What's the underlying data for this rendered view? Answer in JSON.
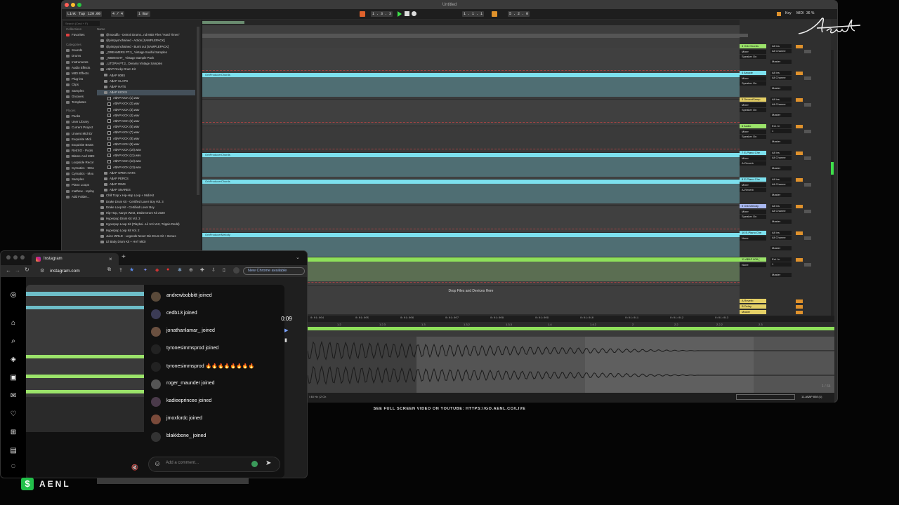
{
  "daw": {
    "title": "Untitled",
    "transport": {
      "link": "Link",
      "tap": "Tap",
      "tempo": "120.00",
      "signature": "4 / 4",
      "quantize": "1 Bar",
      "position": "1 .  3 .  3",
      "loop_start": "1 .  1 .  1",
      "loop_length": "5 .  2 .  0",
      "key_label": "Key",
      "midi_label": "MIDI",
      "cpu": "36 %"
    },
    "browser": {
      "search_placeholder": "Search (Cmd + F)",
      "collections_heading": "Collections",
      "favorites": "Favorites",
      "categories_heading": "Categories",
      "categories": [
        "Sounds",
        "Drums",
        "Instruments",
        "Audio Effects",
        "MIDI Effects",
        "Plug-ins",
        "Clips",
        "Samples",
        "Grooves",
        "Templates"
      ],
      "places_heading": "Places",
      "places": [
        "Packs",
        "User Library",
        "Current Project",
        "Unsent Midi Dr",
        "Exquisite Midi",
        "Exquisite Beats",
        "RetrXO - Pools",
        "Blame And MIDI",
        "Loopside Recor",
        "Cymatics - 90sc",
        "Cymatics - Mou",
        "Samples",
        "Piano Loops",
        "mathew - replay",
        "Add Folder..."
      ],
      "name_header": "Name",
      "files": [
        {
          "name": "@moodfix - Detroit Drums...nd MIDI Files \"Hard Times\"",
          "type": "folder",
          "indent": 1
        },
        {
          "name": "@pimpyonchained - Action [SAMPLEPACK]",
          "type": "folder",
          "indent": 1
        },
        {
          "name": "@pimpyonchained - Burnt out [SAMPLEPACK]",
          "type": "folder",
          "indent": 1
        },
        {
          "name": "_DREAMERS PT.3_ Vintage Soulful Samples",
          "type": "folder",
          "indent": 1
        },
        {
          "name": "_MIDNIGHT_ Vintage Sample Pack",
          "type": "folder",
          "indent": 1
        },
        {
          "name": "_UTOPIA PT.2_ Dreamy Vintage Samples",
          "type": "folder",
          "indent": 1
        },
        {
          "name": "A$AP Rocky Drum Kit",
          "type": "folder",
          "indent": 1
        },
        {
          "name": "A$AP 808S",
          "type": "folder",
          "indent": 2
        },
        {
          "name": "A$AP CLAPS",
          "type": "folder",
          "indent": 2
        },
        {
          "name": "A$AP HATS",
          "type": "folder",
          "indent": 2
        },
        {
          "name": "A$AP KICKS",
          "type": "folder",
          "indent": 2,
          "selected": true
        },
        {
          "name": "A$AP KICK (1).wav",
          "type": "wav",
          "indent": 3
        },
        {
          "name": "A$AP KICK (2).wav",
          "type": "wav",
          "indent": 3
        },
        {
          "name": "A$AP KICK (3).wav",
          "type": "wav",
          "indent": 3
        },
        {
          "name": "A$AP KICK (4).wav",
          "type": "wav",
          "indent": 3
        },
        {
          "name": "A$AP KICK (5).wav",
          "type": "wav",
          "indent": 3
        },
        {
          "name": "A$AP KICK (6).wav",
          "type": "wav",
          "indent": 3
        },
        {
          "name": "A$AP KICK (7).wav",
          "type": "wav",
          "indent": 3
        },
        {
          "name": "A$AP KICK (8).wav",
          "type": "wav",
          "indent": 3
        },
        {
          "name": "A$AP KICK (9).wav",
          "type": "wav",
          "indent": 3
        },
        {
          "name": "A$AP KICK (10).wav",
          "type": "wav",
          "indent": 3
        },
        {
          "name": "A$AP KICK (11).wav",
          "type": "wav",
          "indent": 3
        },
        {
          "name": "A$AP KICK (12).wav",
          "type": "wav",
          "indent": 3
        },
        {
          "name": "A$AP KICK (13).wav",
          "type": "wav",
          "indent": 3
        },
        {
          "name": "A$AP OPEN HATS",
          "type": "folder",
          "indent": 2
        },
        {
          "name": "A$AP PERCS",
          "type": "folder",
          "indent": 2
        },
        {
          "name": "A$AP RIMS",
          "type": "folder",
          "indent": 2
        },
        {
          "name": "A$AP SNARES",
          "type": "folder",
          "indent": 2
        },
        {
          "name": "Chill Trap x Hip-Hop Loop + Midi Kit",
          "type": "folder",
          "indent": 1
        },
        {
          "name": "Drake Drum Kit - Certified Lover Boy Vol. 3",
          "type": "folder",
          "indent": 1
        },
        {
          "name": "Drake Loop Kit - Certified Lover Boy",
          "type": "folder",
          "indent": 1
        },
        {
          "name": "Hip-Hop, Kanye West, Drake Drum Kit 2020",
          "type": "folder",
          "indent": 1
        },
        {
          "name": "Hyperpop Drum Kit Vol. 3",
          "type": "folder",
          "indent": 1
        },
        {
          "name": "Hyperpop Loop Kit (Playboi...Lil Uzi Vert, Trippie Redd)",
          "type": "folder",
          "indent": 1
        },
        {
          "name": "Hyperpop Loop Kit Vol. 2",
          "type": "folder",
          "indent": 1
        },
        {
          "name": "Juice WRLD - Legends Never Die Drum Kit + Bonus",
          "type": "folder",
          "indent": 1
        },
        {
          "name": "Lil Baby Drum Kit + HAT MIDI",
          "type": "folder",
          "indent": 1
        }
      ]
    },
    "clips": [
      {
        "label": "OrbProducerChords",
        "track": 1
      },
      {
        "label": "OrbProducerChords",
        "track": 4
      },
      {
        "label": "OrbProducerChords",
        "track": 5
      },
      {
        "label": "OrbProducerMelody",
        "track": 7
      },
      {
        "label": "808 (1)",
        "track": 8
      }
    ],
    "drop_text": "Drop Files and Devices Here",
    "tracks": [
      {
        "name": "3 Orb Chords",
        "color": "#9be36a",
        "input": "All Ins",
        "channel": "All Channe",
        "mode": "Mixer",
        "out": "Speaker On",
        "route": "Master"
      },
      {
        "name": "4 Arcade",
        "color": "#7ce0ee",
        "input": "All Ins",
        "channel": "All Channe",
        "mode": "Mixer",
        "out": "Speaker On",
        "route": "Master"
      },
      {
        "name": "5 DecentSamp",
        "color": "#e5d066",
        "input": "All Ins",
        "channel": "All Channe",
        "mode": "Mixer",
        "out": "Speaker On",
        "route": "Master"
      },
      {
        "name": "6 Audio",
        "color": "#9be36a",
        "input": "Ext. In",
        "channel": "1",
        "mode": "Mixer",
        "out": "Speaker On",
        "route": "Master"
      },
      {
        "name": "7 E-Piano Che",
        "color": "#7ce0ee",
        "input": "All Ins",
        "channel": "All Channe",
        "mode": "Mixer",
        "out": "A-Reverb",
        "route": "Master"
      },
      {
        "name": "8 E-Piano Che",
        "color": "#7ce0ee",
        "input": "All Ins",
        "channel": "All Channe",
        "mode": "Mixer",
        "out": "A-Reverb",
        "route": "Master"
      },
      {
        "name": "9 Orb Melody",
        "color": "#a9b8f0",
        "input": "All Ins",
        "channel": "All Channe",
        "mode": "Mixer",
        "out": "Speaker On",
        "route": "Master"
      },
      {
        "name": "10 E-Piano Che",
        "color": "#7ce0ee",
        "input": "All Ins",
        "channel": "All Channe",
        "mode": "None",
        "out": "",
        "route": "Master"
      },
      {
        "name": "11 A$AP 808 (",
        "color": "#9be36a",
        "input": "Ext. In",
        "channel": "1",
        "mode": "None",
        "out": "",
        "route": "Master"
      }
    ],
    "returns": [
      {
        "name": "A Reverb",
        "color": "#e5d066"
      },
      {
        "name": "B Delay",
        "color": "#e5d066"
      },
      {
        "name": "Master",
        "color": "#e5d066"
      }
    ],
    "detail": {
      "ruler_ticks": [
        "0:01:004",
        "0:01:005",
        "0:01:006",
        "0:01:007",
        "0:01:008",
        "0:01:009",
        "0:01:010",
        "0:01:011",
        "0:01:012",
        "0:01:013"
      ],
      "bar_ticks": [
        "1.2",
        "1.2.3",
        "1.3",
        "1.3.2",
        "1.3.3",
        "1.4",
        "1.4.2",
        "2",
        "2.2",
        "2.2.2",
        "2.3"
      ],
      "page": "1 / 64",
      "status_left": "/ 48 Hz | 2 Ch",
      "status_right": "11-A$AP 808 (1)"
    }
  },
  "browser_window": {
    "tab_title": "Instagram",
    "url": "instagram.com",
    "update_text": "New Chrome available",
    "comments": [
      {
        "text": "andrewbobbitt joined"
      },
      {
        "text": "cedb13 joined"
      },
      {
        "text": "jonathanlamar_ joined"
      },
      {
        "text": "tyronesimmsprod joined"
      },
      {
        "text": "tyronesimmsprod 🔥🔥🔥🔥🔥🔥🔥🔥"
      },
      {
        "text": "roger_maunder joined"
      },
      {
        "text": "kadieeprincee joined"
      },
      {
        "text": "jmoxfordc joined"
      },
      {
        "text": "blakkbone_ joined"
      }
    ],
    "comment_placeholder": "Add a comment...",
    "timer": "0:09"
  },
  "overlay": {
    "youtube_text": "SEE FULL SCREEN VIDEO ON YOUTUBE: HTTPS://GO.AENL.CO/LIVE",
    "signature": "Aenl",
    "brand": "AENL",
    "brand_icon": "$"
  },
  "colors": {
    "clip_cyan": "#7ce0ee",
    "track_green": "#9be36a",
    "accent_orange": "#e0922c"
  }
}
